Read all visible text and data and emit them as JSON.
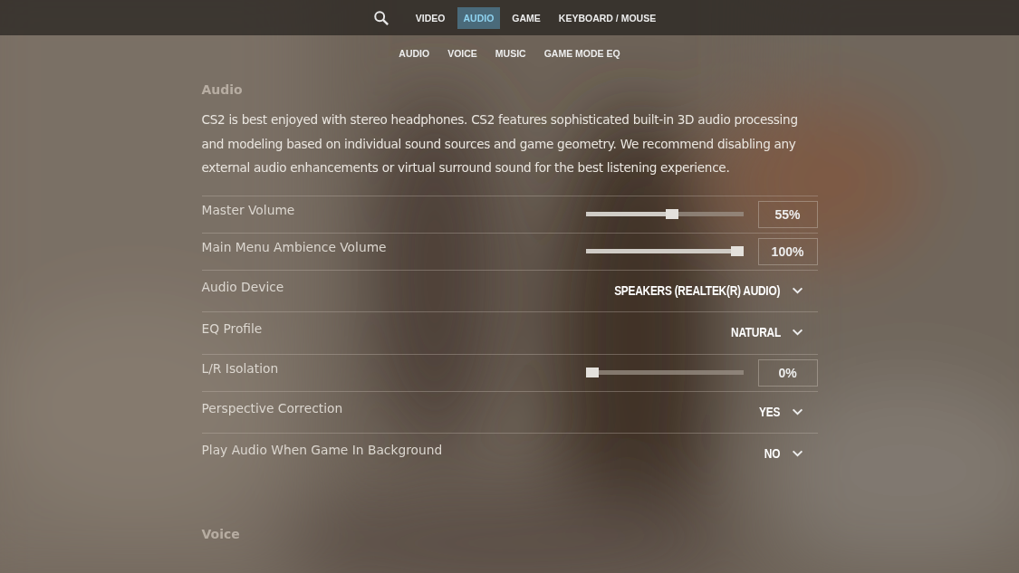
{
  "nav": {
    "tabs": [
      {
        "label": "VIDEO",
        "selected": false
      },
      {
        "label": "AUDIO",
        "selected": true
      },
      {
        "label": "GAME",
        "selected": false
      },
      {
        "label": "KEYBOARD / MOUSE",
        "selected": false
      }
    ],
    "subtabs": [
      "AUDIO",
      "VOICE",
      "MUSIC",
      "GAME MODE EQ"
    ]
  },
  "section": {
    "title": "Audio",
    "description": "CS2 is best enjoyed with stereo headphones. CS2 features sophisticated built-in 3D audio processing and modeling based on individual sound sources and game geometry. We recommend disabling any external audio enhancements or virtual surround sound for the best listening experience.",
    "settings": [
      {
        "kind": "slider",
        "label": "Master Volume",
        "level": 0.55,
        "reading": "55%"
      },
      {
        "kind": "slider",
        "label": "Main Menu Ambience Volume",
        "level": 1,
        "reading": "100%"
      },
      {
        "kind": "dropdown",
        "label": "Audio Device",
        "value": "SPEAKERS (REALTEK(R) AUDIO)"
      },
      {
        "kind": "dropdown",
        "label": "EQ Profile",
        "value": "NATURAL"
      },
      {
        "kind": "slider",
        "label": "L/R Isolation",
        "level": 0,
        "reading": "0%"
      },
      {
        "kind": "dropdown",
        "label": "Perspective Correction",
        "value": "YES"
      },
      {
        "kind": "dropdown",
        "label": "Play Audio When Game In Background",
        "value": "NO"
      }
    ]
  },
  "next_section": {
    "title": "Voice"
  }
}
